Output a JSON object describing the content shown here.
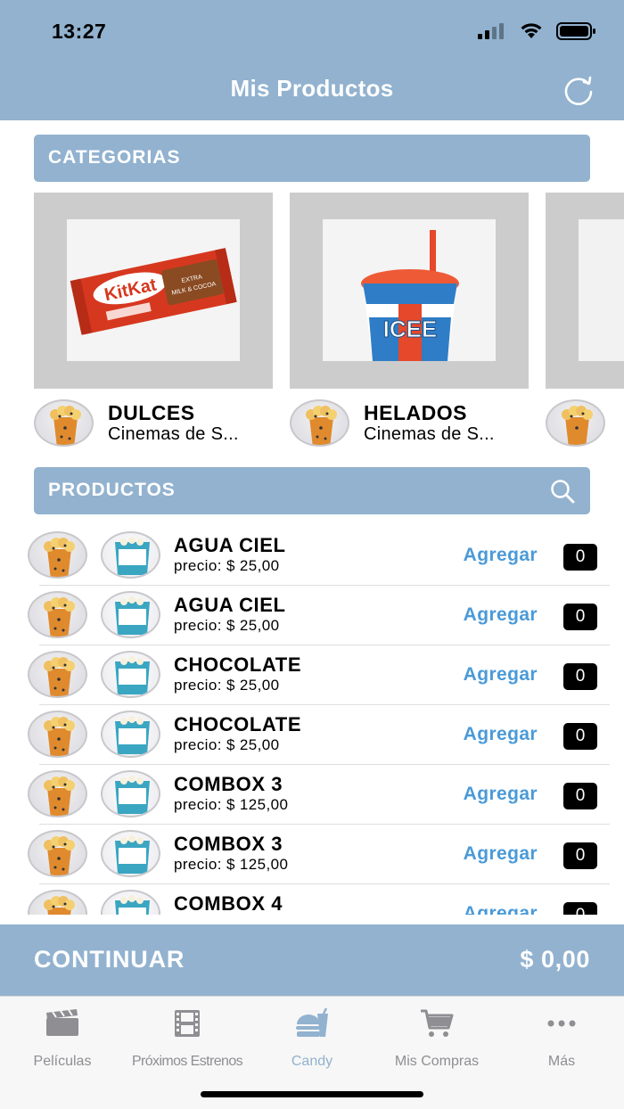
{
  "status_bar": {
    "time": "13:27"
  },
  "nav": {
    "title": "Mis Productos"
  },
  "categories_section": {
    "title": "CATEGORIAS"
  },
  "categories": [
    {
      "name": "DULCES",
      "subtitle": "Cinemas de S..."
    },
    {
      "name": "HELADOS",
      "subtitle": "Cinemas de S..."
    }
  ],
  "products_section": {
    "title": "PRODUCTOS"
  },
  "products": [
    {
      "name": "AGUA CIEL",
      "price": "precio: $ 25,00",
      "add_label": "Agregar",
      "qty": "0"
    },
    {
      "name": "AGUA CIEL",
      "price": "precio: $ 25,00",
      "add_label": "Agregar",
      "qty": "0"
    },
    {
      "name": "CHOCOLATE",
      "price": "precio: $ 25,00",
      "add_label": "Agregar",
      "qty": "0"
    },
    {
      "name": "CHOCOLATE",
      "price": "precio: $ 25,00",
      "add_label": "Agregar",
      "qty": "0"
    },
    {
      "name": "COMBOX 3",
      "price": "precio: $ 125,00",
      "add_label": "Agregar",
      "qty": "0"
    },
    {
      "name": "COMBOX 3",
      "price": "precio: $ 125,00",
      "add_label": "Agregar",
      "qty": "0"
    },
    {
      "name": "COMBOX 4",
      "price": "",
      "add_label": "Agregar",
      "qty": "0"
    }
  ],
  "continue_bar": {
    "label": "CONTINUAR",
    "total": "$ 0,00"
  },
  "tabs": [
    {
      "label": "Películas",
      "icon": "clapperboard-icon"
    },
    {
      "label": "Próximos Estrenos",
      "icon": "film-strip-icon"
    },
    {
      "label": "Candy",
      "icon": "candy-icon",
      "active": true
    },
    {
      "label": "Mis Compras",
      "icon": "cart-icon"
    },
    {
      "label": "Más",
      "icon": "more-icon"
    }
  ],
  "colors": {
    "accent": "#92b2cf",
    "link": "#4a9ad8",
    "tab_inactive": "#8e8e93"
  }
}
